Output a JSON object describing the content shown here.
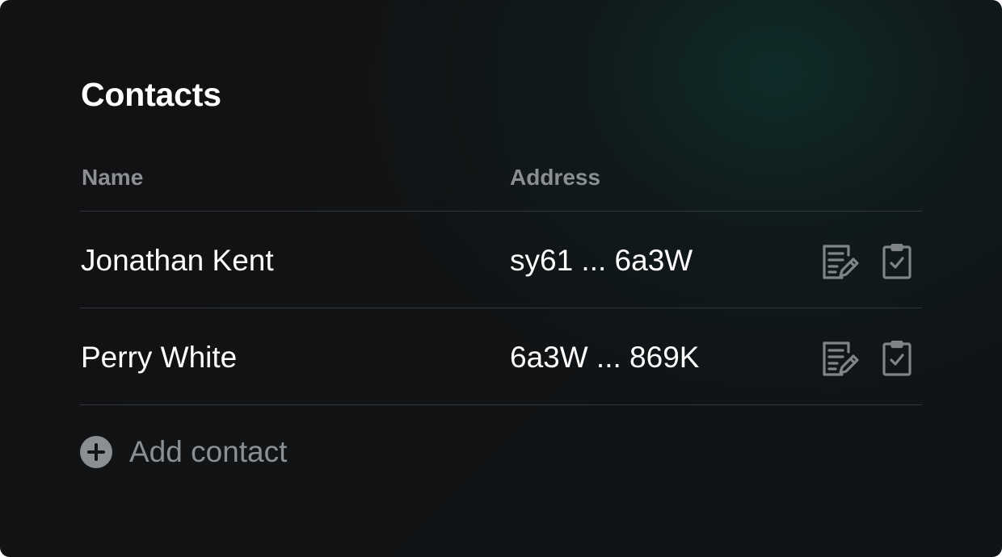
{
  "page": {
    "title": "Contacts"
  },
  "table": {
    "columns": {
      "name": "Name",
      "address": "Address"
    },
    "rows": [
      {
        "name": "Jonathan Kent",
        "address": "sy61 ... 6a3W",
        "actions": [
          "edit-icon",
          "clipboard-check-icon"
        ]
      },
      {
        "name": "Perry White",
        "address": "6a3W ... 869K",
        "actions": [
          "edit-icon",
          "clipboard-check-icon"
        ]
      }
    ]
  },
  "add_contact": {
    "label": "Add contact",
    "icon": "plus-circle-icon"
  },
  "colors": {
    "background": "#111315",
    "accent_glow": "#0e3430",
    "text_primary": "#ffffff",
    "text_muted": "#8c8f91",
    "icon": "#7f8584",
    "divider": "#33383a"
  }
}
